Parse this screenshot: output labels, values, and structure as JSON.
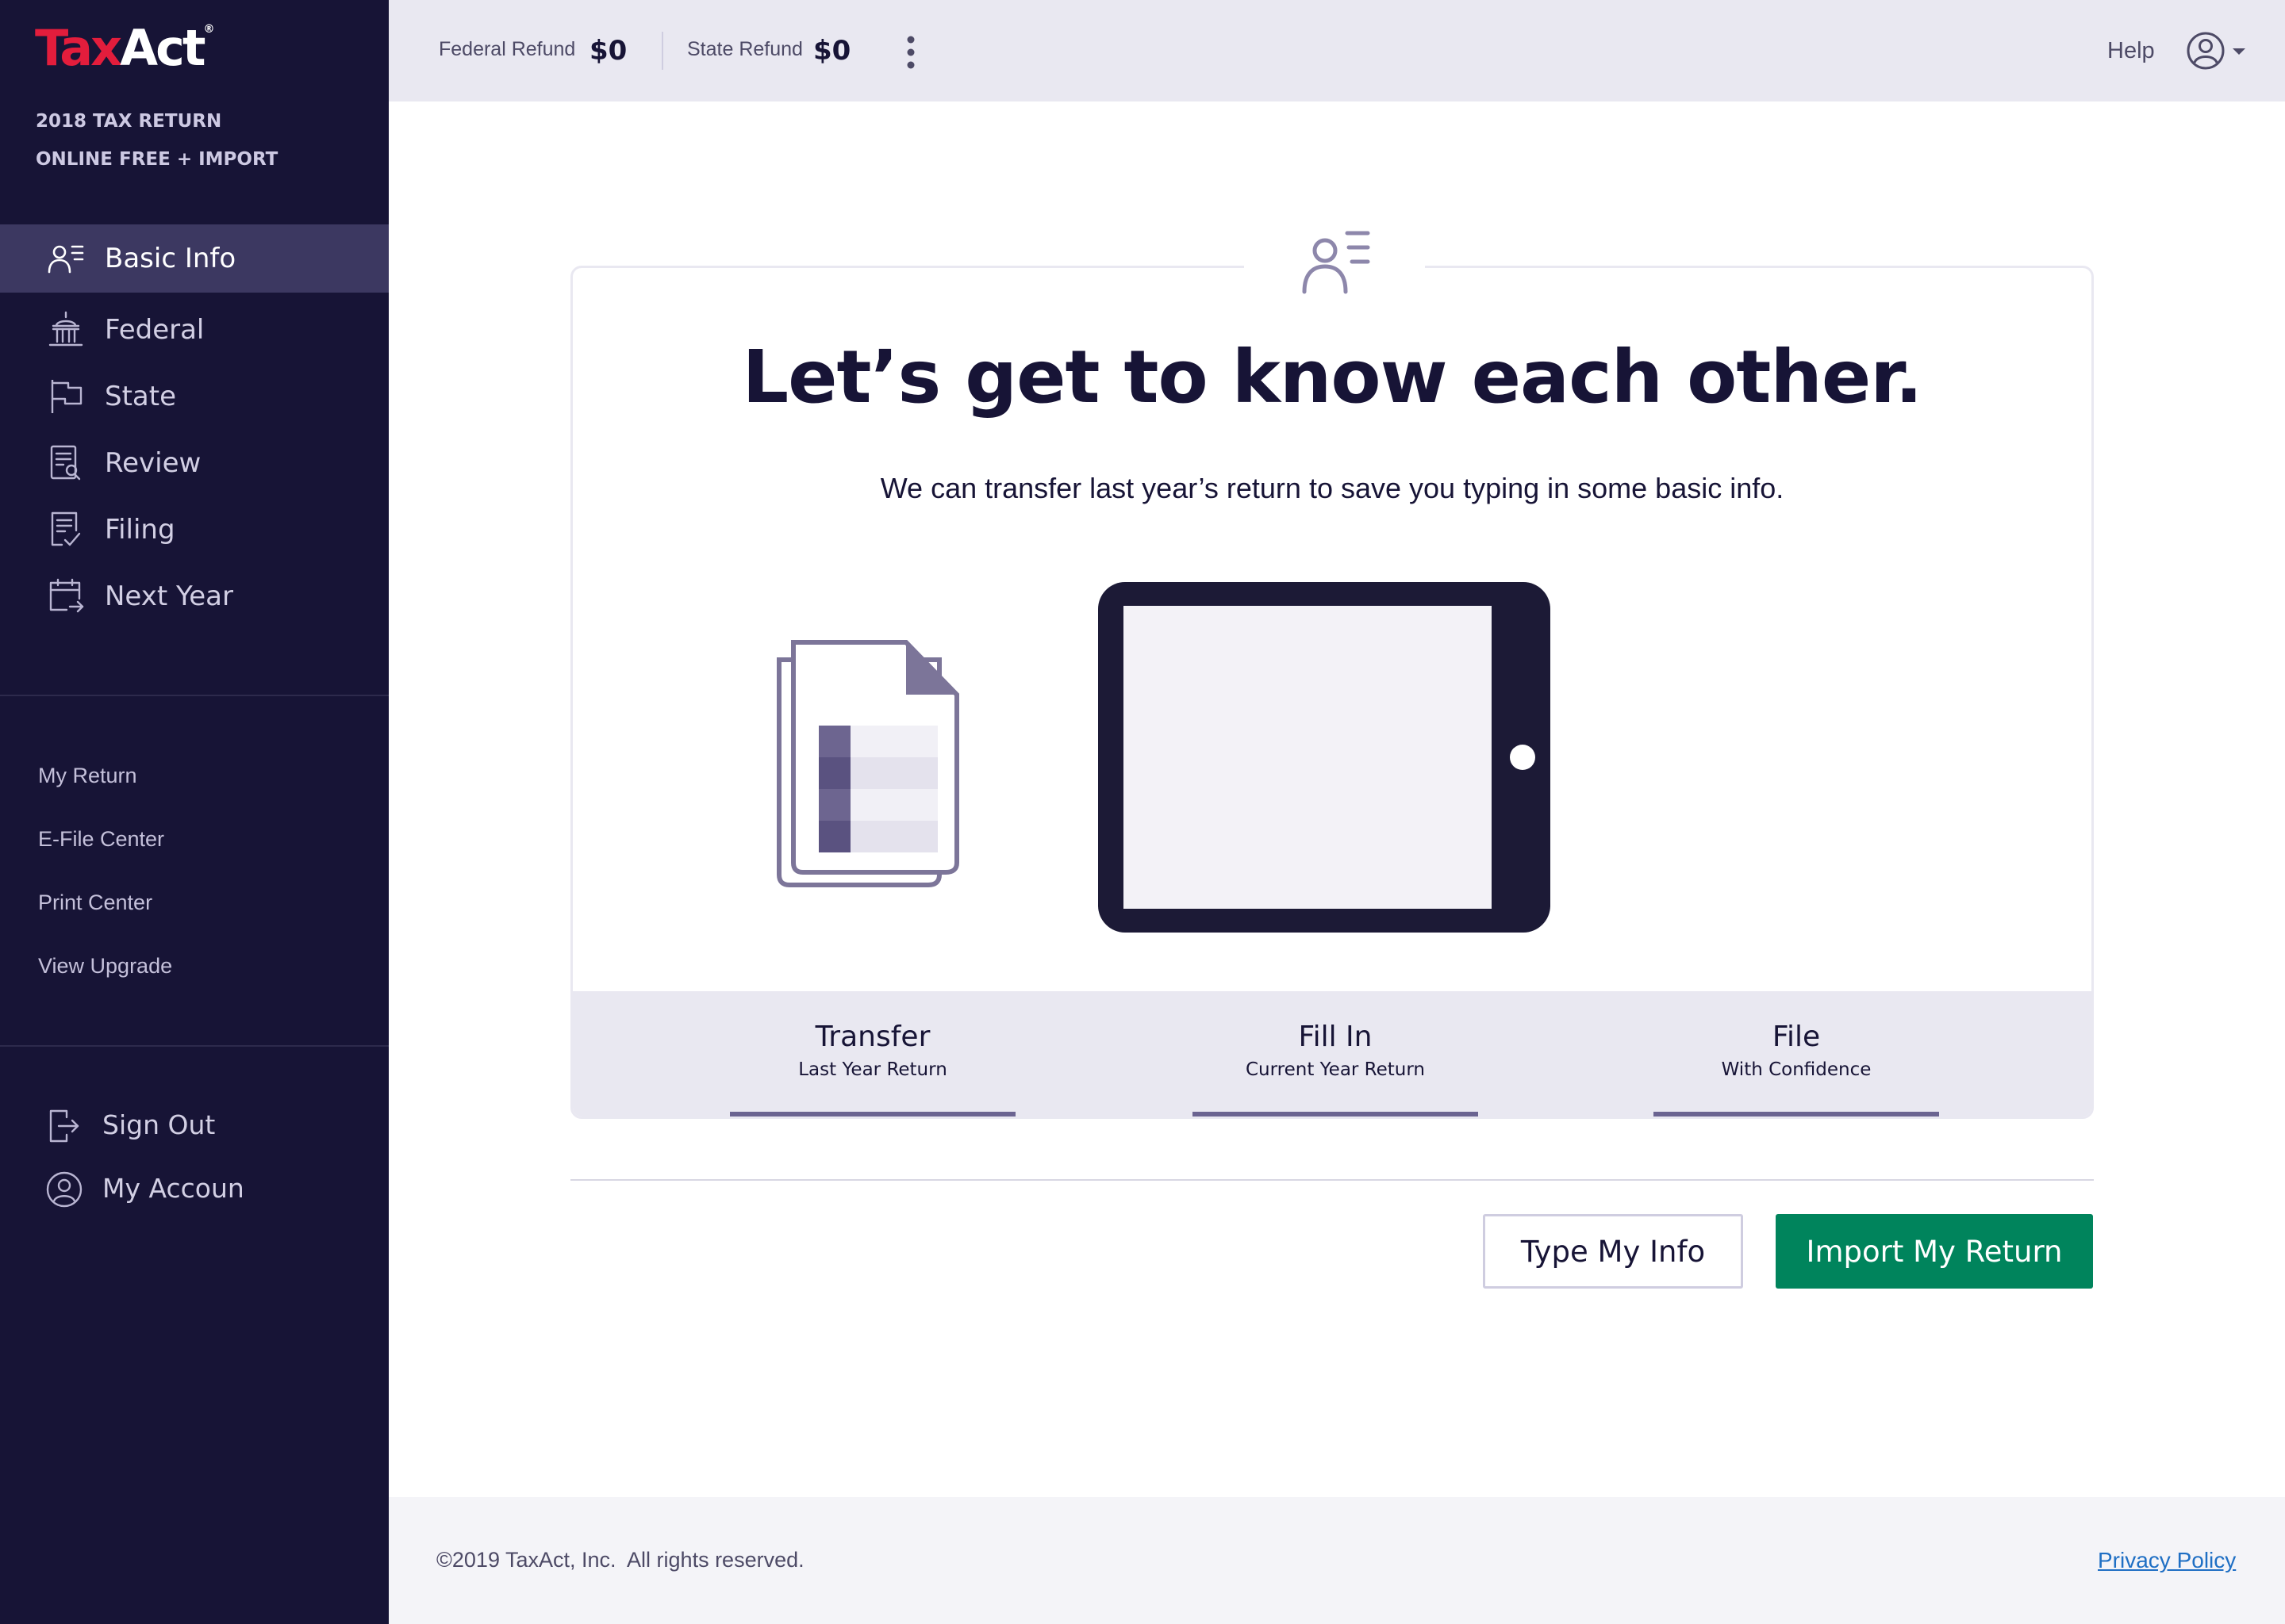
{
  "brand": {
    "name_red": "Tax",
    "name_white": "Act",
    "mark": "®",
    "red": "#e31d3c",
    "navy": "#171436"
  },
  "sidebar": {
    "product_lines": [
      "2018 TAX RETURN",
      "ONLINE FREE + IMPORT"
    ],
    "nav": [
      {
        "label": "Basic Info",
        "icon": "person-list-icon",
        "active": true
      },
      {
        "label": "Federal",
        "icon": "capitol-building-icon"
      },
      {
        "label": "State",
        "icon": "flag-icon"
      },
      {
        "label": "Review",
        "icon": "document-search-icon"
      },
      {
        "label": "Filing",
        "icon": "document-check-icon"
      },
      {
        "label": "Next Year",
        "icon": "calendar-arrow-icon"
      }
    ],
    "links": [
      "My Return",
      "E-File Center",
      "Print Center",
      "View Upgrade"
    ],
    "account": [
      {
        "label": "Sign Out",
        "icon": "sign-out-icon"
      },
      {
        "label": "My Accoun",
        "icon": "user-circle-icon"
      }
    ]
  },
  "header": {
    "federal_label": "Federal Refund",
    "federal_amount": "$0",
    "state_label": "State Refund",
    "state_amount": "$0",
    "help": "Help"
  },
  "main": {
    "heading": "Let’s get to know each other.",
    "subtext": "We can transfer last year’s return to save you typing in some basic info.",
    "steps": [
      {
        "title": "Transfer",
        "subtitle": "Last Year Return"
      },
      {
        "title": "Fill In",
        "subtitle": "Current Year Return"
      },
      {
        "title": "File",
        "subtitle": "With Confidence"
      }
    ],
    "buttons": {
      "type": "Type My Info",
      "import": "Import My Return"
    },
    "accent": "#00845c"
  },
  "footer": {
    "copyright": "©2019 TaxAct, Inc.  All rights reserved.",
    "privacy": "Privacy Policy"
  }
}
